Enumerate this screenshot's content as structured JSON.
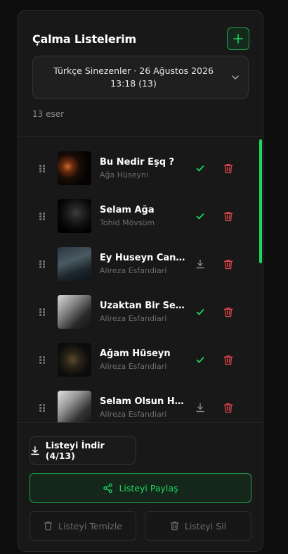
{
  "header": {
    "title": "Çalma Listelerim",
    "add_icon": "plus-icon"
  },
  "playlist_select": {
    "selected": "Türkçe Sinezenler · 26 Ağustos 2026 13:18 (13)"
  },
  "track_count": "13 eser",
  "tracks": [
    {
      "title": "Bu Nedir Eşq ?",
      "artist": "Ağa Hüseyni",
      "status": "downloaded"
    },
    {
      "title": "Selam Ağa",
      "artist": "Tohid Mövsüm",
      "status": "downloaded"
    },
    {
      "title": "Ey Huseyn Canem",
      "artist": "Alireza Esfandiari",
      "status": "not-downloaded"
    },
    {
      "title": "Uzaktan Bir Sela...",
      "artist": "Alireza Esfandiari",
      "status": "downloaded"
    },
    {
      "title": "Ağam Hüseyn",
      "artist": "Alireza Esfandiari",
      "status": "downloaded"
    },
    {
      "title": "Selam Olsun Hüs...",
      "artist": "Alireza Esfandiari",
      "status": "not-downloaded"
    }
  ],
  "actions": {
    "download": "Listeyi İndir (4/13)",
    "share": "Listeyi Paylaş",
    "clear": "Listeyi Temizle",
    "delete": "Listeyi Sil"
  },
  "colors": {
    "accent": "#1ed760",
    "danger": "#e0464b",
    "background": "#181818"
  }
}
